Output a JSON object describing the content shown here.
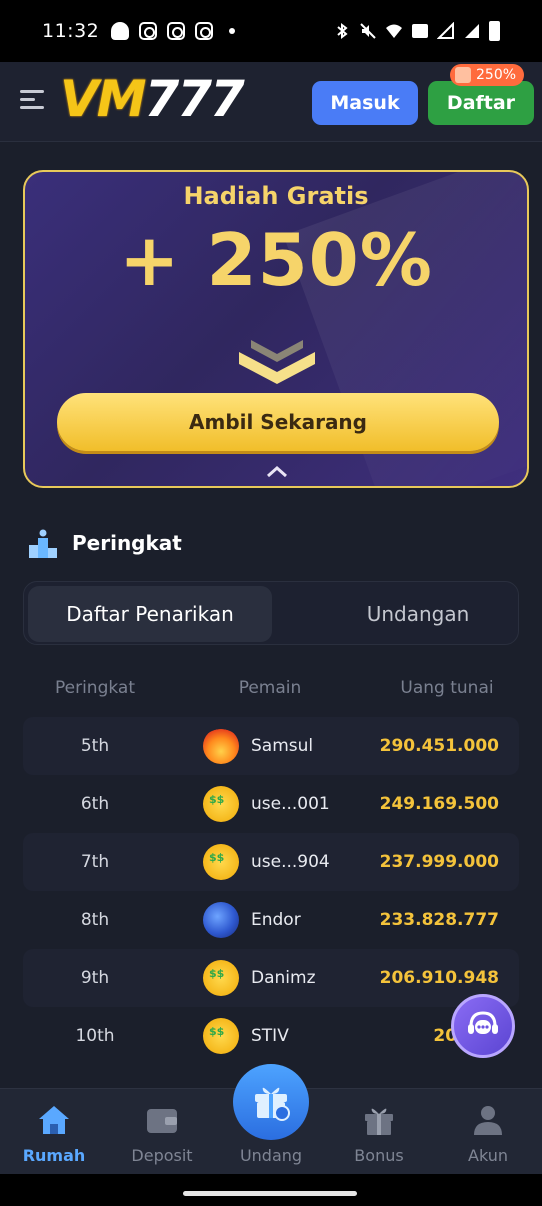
{
  "status_bar": {
    "time": "11:32"
  },
  "header": {
    "logo": {
      "vm": "VM",
      "digits": "777"
    },
    "login_label": "Masuk",
    "register_label": "Daftar",
    "register_badge": "250%"
  },
  "promo": {
    "title": "Hadiah Gratis",
    "bonus": "+ 250%",
    "cta_label": "Ambil Sekarang"
  },
  "ranking": {
    "title": "Peringkat",
    "tabs": [
      {
        "label": "Daftar Penarikan",
        "active": true
      },
      {
        "label": "Undangan",
        "active": false
      }
    ],
    "columns": {
      "rank": "Peringkat",
      "player": "Pemain",
      "cash": "Uang tunai"
    },
    "rows": [
      {
        "rank": "5th",
        "name": "Samsul",
        "cash": "290.451.000",
        "avatar": "fire-avatar-icon"
      },
      {
        "rank": "6th",
        "name": "use...001",
        "cash": "249.169.500",
        "avatar": "money-face-avatar-icon"
      },
      {
        "rank": "7th",
        "name": "use...904",
        "cash": "237.999.000",
        "avatar": "money-face-avatar-icon"
      },
      {
        "rank": "8th",
        "name": "Endor",
        "cash": "233.828.777",
        "avatar": "blue-avatar-icon"
      },
      {
        "rank": "9th",
        "name": "Danimz",
        "cash": "206.910.948",
        "avatar": "money-face-avatar-icon"
      },
      {
        "rank": "10th",
        "name": "STIV",
        "cash": "206.80",
        "avatar": "money-face-avatar-icon"
      }
    ]
  },
  "bottom_nav": [
    {
      "label": "Rumah",
      "icon": "home-icon",
      "active": true
    },
    {
      "label": "Deposit",
      "icon": "wallet-icon",
      "active": false
    },
    {
      "label": "Undang",
      "icon": "gift-box-icon",
      "active": false
    },
    {
      "label": "Bonus",
      "icon": "gift-icon",
      "active": false
    },
    {
      "label": "Akun",
      "icon": "user-icon",
      "active": false
    }
  ],
  "colors": {
    "accent_gold": "#f6d46a",
    "login_blue": "#4a7cf6",
    "register_green": "#2ea043",
    "cash_gold": "#f4c33b",
    "active_nav": "#5aa8ff"
  }
}
